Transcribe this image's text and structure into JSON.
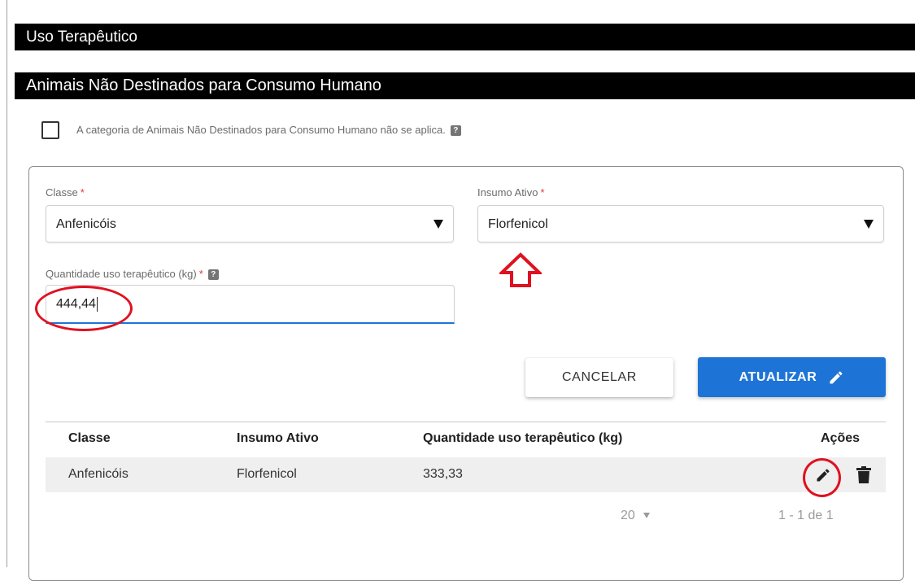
{
  "sections": {
    "therapeutic_use": "Uso Terapêutico",
    "non_food_animals": "Animais Não Destinados para Consumo Humano"
  },
  "not_applicable": {
    "label": "A categoria de Animais Não Destinados para Consumo Humano não se aplica.",
    "checked": false,
    "help": "?"
  },
  "form": {
    "class_label": "Classe",
    "class_value": "Anfenicóis",
    "active_label": "Insumo Ativo",
    "active_value": "Florfenicol",
    "quantity_label": "Quantidade uso terapêutico (kg)",
    "quantity_value": "444,44",
    "required_mark": "*",
    "help": "?"
  },
  "buttons": {
    "cancel": "CANCELAR",
    "update": "ATUALIZAR"
  },
  "table": {
    "headers": [
      "Classe",
      "Insumo Ativo",
      "Quantidade uso terapêutico (kg)",
      "Ações"
    ],
    "rows": [
      {
        "classe": "Anfenicóis",
        "insumo": "Florfenicol",
        "quantidade": "333,33"
      }
    ]
  },
  "pagination": {
    "page_size": "20",
    "info": "1 - 1 de 1"
  },
  "colors": {
    "accent": "#1e74d6",
    "annotation_red": "#e0111f",
    "section_bar": "#000000"
  }
}
